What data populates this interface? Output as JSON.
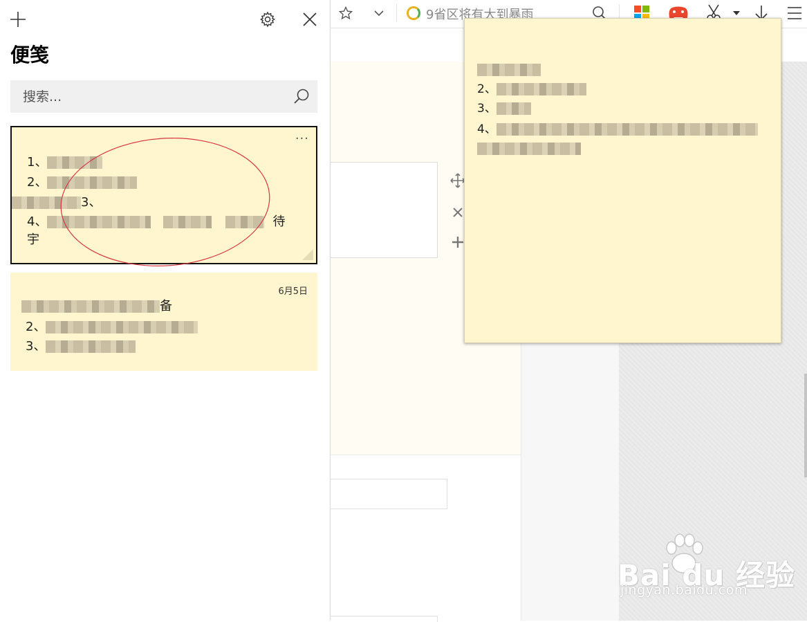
{
  "panel": {
    "title": "便笺",
    "search_placeholder": "搜索...",
    "icons": {
      "add": "plus-icon",
      "settings": "gear-icon",
      "close": "close-icon",
      "search": "search-icon"
    }
  },
  "notes": [
    {
      "more": "···",
      "lines": [
        "1、",
        "2、",
        "3、",
        "4、",
        "宇"
      ],
      "highlighted": true,
      "trailing_text": "待"
    },
    {
      "date": "6月5日",
      "lines": [
        "",
        "2、",
        "3、"
      ],
      "line1_suffix": "备"
    }
  ],
  "floating_note": {
    "lines": [
      "",
      "2、",
      "3、",
      "4、",
      ""
    ]
  },
  "browser": {
    "news_text": "9省区将有大到暴雨",
    "toolbar_icons": [
      "star-icon",
      "chevron-down-icon",
      "news-icon",
      "search-icon",
      "apps-icon",
      "game-icon",
      "scissors-icon",
      "dropdown-arrow-icon",
      "download-icon",
      "menu-icon"
    ],
    "side_tools": [
      "move-icon",
      "delete-icon",
      "add-icon"
    ]
  },
  "watermark": {
    "logo": "Bai du 经验",
    "sub": "jingyan.baidu.com"
  },
  "colors": {
    "note_bg": "#fff5cf",
    "annotation": "#d9363e",
    "panel_bg": "#ffffff"
  }
}
